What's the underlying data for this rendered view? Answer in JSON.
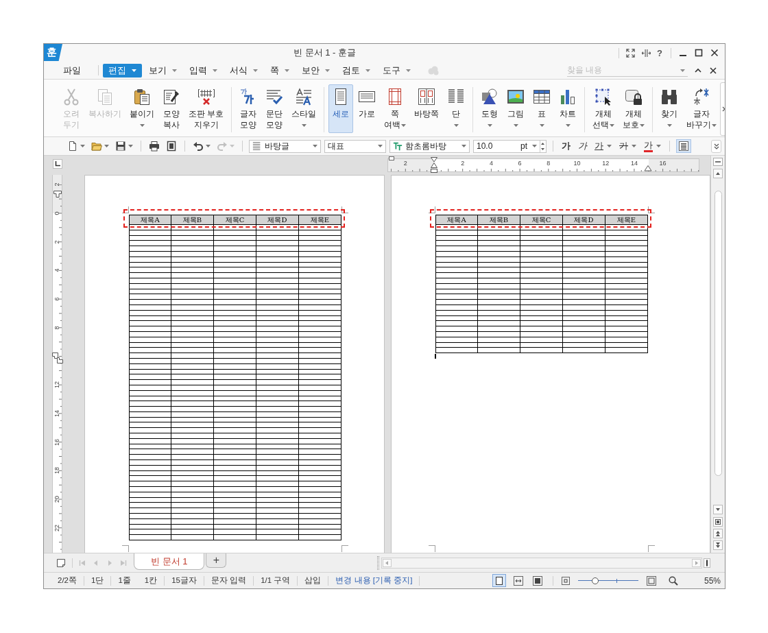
{
  "window": {
    "app_logo": "훈",
    "title": "빈 문서 1 - 훈글",
    "help": "?"
  },
  "menu": {
    "items": [
      {
        "label": "파일",
        "selected": false,
        "dropdown": false
      },
      {
        "label": "편집",
        "selected": true,
        "dropdown": true
      },
      {
        "label": "보기",
        "selected": false,
        "dropdown": true
      },
      {
        "label": "입력",
        "selected": false,
        "dropdown": true
      },
      {
        "label": "서식",
        "selected": false,
        "dropdown": true
      },
      {
        "label": "쪽",
        "selected": false,
        "dropdown": true
      },
      {
        "label": "보안",
        "selected": false,
        "dropdown": true
      },
      {
        "label": "검토",
        "selected": false,
        "dropdown": true
      },
      {
        "label": "도구",
        "selected": false,
        "dropdown": true
      }
    ],
    "search": {
      "placeholder": "찾을 내용"
    }
  },
  "ribbon": {
    "groups": [
      {
        "items": [
          {
            "label": "오려\n두기",
            "disabled": true,
            "dropdown": false
          },
          {
            "label": "복사하기",
            "disabled": true,
            "dropdown": false
          },
          {
            "label": "붙이기",
            "disabled": false,
            "dropdown": true
          },
          {
            "label": "모양\n복사",
            "disabled": false,
            "dropdown": false
          },
          {
            "label": "조판 부호\n지우기",
            "disabled": false,
            "dropdown": false
          }
        ]
      },
      {
        "items": [
          {
            "label": "글자\n모양",
            "dropdown": false
          },
          {
            "label": "문단\n모양",
            "dropdown": false
          },
          {
            "label": "스타일",
            "dropdown": true
          }
        ]
      },
      {
        "items": [
          {
            "label": "세로",
            "selected": true,
            "dropdown": false
          },
          {
            "label": "가로",
            "selected": false,
            "dropdown": false
          },
          {
            "label": "쪽\n여백",
            "selected": false,
            "dropdown": true
          },
          {
            "label": "바탕쪽",
            "selected": false,
            "dropdown": false
          },
          {
            "label": "단",
            "selected": false,
            "dropdown": true
          }
        ]
      },
      {
        "items": [
          {
            "label": "도형",
            "dropdown": true
          },
          {
            "label": "그림",
            "dropdown": true
          },
          {
            "label": "표",
            "dropdown": true
          },
          {
            "label": "차트",
            "dropdown": true
          }
        ]
      },
      {
        "items": [
          {
            "label": "개체\n선택",
            "dropdown": true
          },
          {
            "label": "개체\n보호",
            "dropdown": true
          }
        ]
      },
      {
        "items": [
          {
            "label": "찾기",
            "dropdown": true
          },
          {
            "label": "글자\n바꾸기",
            "dropdown": true
          }
        ]
      }
    ]
  },
  "toolbar": {
    "groups": [
      {
        "items": [
          {
            "kind": "icon",
            "dropdown": true,
            "disabled": false
          },
          {
            "kind": "icon",
            "dropdown": true,
            "disabled": false
          },
          {
            "kind": "icon",
            "dropdown": true,
            "disabled": false
          }
        ]
      },
      {
        "items": [
          {
            "kind": "icon",
            "dropdown": false,
            "disabled": false
          },
          {
            "kind": "icon",
            "dropdown": false,
            "disabled": false
          }
        ]
      },
      {
        "items": [
          {
            "kind": "icon",
            "dropdown": true,
            "disabled": false
          },
          {
            "kind": "icon",
            "dropdown": true,
            "disabled": true
          }
        ]
      },
      {
        "items": [
          {
            "kind": "combo",
            "value": "바탕글"
          },
          {
            "kind": "combo",
            "value": "대표"
          },
          {
            "kind": "combo",
            "value": "함초롬바탕"
          },
          {
            "kind": "size",
            "value": "10.0",
            "unit": "pt"
          }
        ]
      },
      {
        "items": [
          {
            "kind": "bold",
            "label": "가",
            "dropdown": false
          },
          {
            "kind": "italic",
            "label": "가",
            "dropdown": false
          },
          {
            "kind": "underline",
            "label": "가",
            "dropdown": true
          },
          {
            "kind": "strike",
            "label": "가",
            "dropdown": true
          },
          {
            "kind": "color",
            "label": "가",
            "dropdown": true
          }
        ]
      },
      {
        "items": [
          {
            "kind": "toggle",
            "selected": true
          }
        ]
      }
    ]
  },
  "document": {
    "horizontal_ruler": {
      "labels": [
        "2",
        "2",
        "4",
        "6",
        "8",
        "10",
        "12",
        "14",
        "16"
      ]
    },
    "vertical_ruler": {
      "labels": [
        "2",
        "0",
        "2",
        "4",
        "6",
        "8",
        "12",
        "14",
        "16",
        "18",
        "20",
        "22"
      ]
    },
    "pages": [
      {
        "active": false,
        "cursor": false,
        "table": {
          "header": [
            "제목A",
            "제목B",
            "제목C",
            "제목D",
            "제목E"
          ],
          "highlighted": true,
          "rows": [
            {
              "kind": "blank"
            },
            {
              "kind": "blank"
            },
            {
              "kind": "blank"
            },
            {
              "kind": "blank"
            },
            {
              "kind": "blank"
            },
            {
              "kind": "blank"
            },
            {
              "kind": "blank"
            },
            {
              "kind": "blank"
            },
            {
              "kind": "blank"
            },
            {
              "kind": "blank"
            },
            {
              "kind": "blank"
            },
            {
              "kind": "blank"
            },
            {
              "kind": "blank"
            },
            {
              "kind": "blank"
            },
            {
              "kind": "blank"
            },
            {
              "kind": "blank"
            },
            {
              "kind": "blank"
            },
            {
              "kind": "blank"
            },
            {
              "kind": "blank"
            },
            {
              "kind": "blank"
            },
            {
              "kind": "blank"
            },
            {
              "kind": "blank"
            },
            {
              "kind": "blank"
            },
            {
              "kind": "blank"
            },
            {
              "kind": "blank"
            },
            {
              "kind": "blank"
            },
            {
              "kind": "blank"
            },
            {
              "kind": "blank"
            },
            {
              "kind": "blank"
            },
            {
              "kind": "blank"
            },
            {
              "kind": "blank"
            },
            {
              "kind": "blank"
            },
            {
              "kind": "blank"
            },
            {
              "kind": "blank"
            },
            {
              "kind": "blank"
            },
            {
              "kind": "blank"
            },
            {
              "kind": "blank"
            },
            {
              "kind": "blank"
            },
            {
              "kind": "blank"
            },
            {
              "kind": "blank"
            },
            {
              "kind": "blank"
            },
            {
              "kind": "blank"
            },
            {
              "kind": "blank"
            },
            {
              "kind": "blank"
            },
            {
              "kind": "blank"
            },
            {
              "kind": "blank"
            },
            {
              "kind": "blank"
            },
            {
              "kind": "blank"
            },
            {
              "kind": "blank"
            },
            {
              "kind": "blank"
            },
            {
              "kind": "blank"
            },
            {
              "kind": "blank"
            },
            {
              "kind": "blank"
            },
            {
              "kind": "blank"
            },
            {
              "kind": "blank"
            },
            {
              "kind": "blank"
            },
            {
              "kind": "blank"
            },
            {
              "kind": "blank"
            },
            {
              "kind": "blank"
            }
          ]
        }
      },
      {
        "active": true,
        "cursor": true,
        "table": {
          "header": [
            "제목A",
            "제목B",
            "제목C",
            "제목D",
            "제목E"
          ],
          "highlighted": true,
          "rows": [
            {
              "kind": "blank"
            },
            {
              "kind": "blank"
            },
            {
              "kind": "blank"
            },
            {
              "kind": "blank"
            },
            {
              "kind": "blank"
            },
            {
              "kind": "blank"
            },
            {
              "kind": "blank"
            },
            {
              "kind": "blank"
            },
            {
              "kind": "blank"
            },
            {
              "kind": "blank"
            },
            {
              "kind": "blank"
            },
            {
              "kind": "blank"
            },
            {
              "kind": "blank"
            },
            {
              "kind": "blank"
            },
            {
              "kind": "blank"
            },
            {
              "kind": "blank"
            },
            {
              "kind": "blank"
            },
            {
              "kind": "blank"
            },
            {
              "kind": "blank"
            },
            {
              "kind": "blank"
            },
            {
              "kind": "blank"
            },
            {
              "kind": "blank"
            },
            {
              "kind": "blank"
            },
            {
              "kind": "blank"
            }
          ]
        }
      }
    ]
  },
  "tab_bar": {
    "navigation_disabled": true,
    "tabs": [
      {
        "label": "빈 문서 1",
        "selected": true
      }
    ],
    "new_tab": "+"
  },
  "status_bar": {
    "groups": [
      [
        "2/2쪽"
      ],
      [
        "1단"
      ],
      [
        "1줄",
        "1칸"
      ],
      [
        "15글자"
      ],
      [
        "문자 입력"
      ],
      [
        "1/1 구역"
      ],
      [
        "삽입"
      ]
    ],
    "track_changes": "변경 내용 [기록 중지]",
    "views": [
      {
        "selected": true
      },
      {
        "selected": false
      },
      {
        "selected": false
      }
    ],
    "zoom": {
      "level": 0.29,
      "reading": "55%"
    }
  }
}
